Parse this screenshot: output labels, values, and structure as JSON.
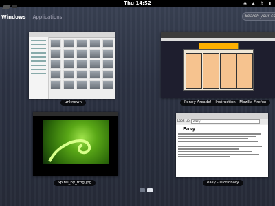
{
  "topbar": {
    "clock": "Thu 14:52"
  },
  "view_tabs": {
    "windows": "Windows",
    "applications": "Applications"
  },
  "search": {
    "placeholder": "Search your compu"
  },
  "windows": [
    {
      "caption": "unknown"
    },
    {
      "caption": "Penny Arcade! - Instruction - Mozilla Firefox"
    },
    {
      "caption": "Spiral_by_frog.jpg"
    },
    {
      "caption": "easy - Dictionary"
    }
  ],
  "dictionary": {
    "lookup_label": "Look up:",
    "query": "easy",
    "headword": "Easy"
  },
  "workspaces": {
    "count": 2,
    "active": 2
  },
  "icons": [
    "activities-icon",
    "accessibility-icon",
    "network-icon",
    "volume-icon",
    "battery-icon"
  ]
}
